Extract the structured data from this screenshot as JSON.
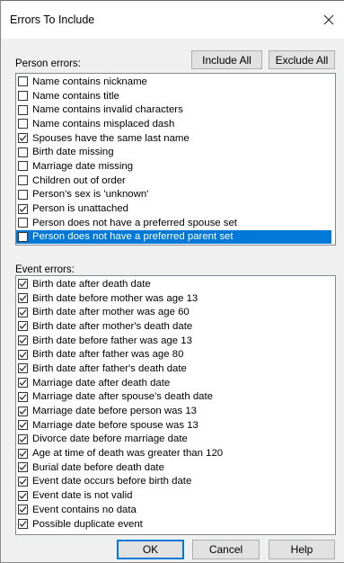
{
  "dialog": {
    "title": "Errors To Include"
  },
  "person": {
    "label": "Person errors:",
    "include_all": "Include All",
    "exclude_all": "Exclude All",
    "items": [
      {
        "label": "Name contains nickname",
        "checked": false
      },
      {
        "label": "Name contains title",
        "checked": false
      },
      {
        "label": "Name contains invalid characters",
        "checked": false
      },
      {
        "label": "Name contains misplaced dash",
        "checked": false
      },
      {
        "label": "Spouses have the same last name",
        "checked": true
      },
      {
        "label": "Birth date missing",
        "checked": false
      },
      {
        "label": "Marriage date missing",
        "checked": false
      },
      {
        "label": "Children out of order",
        "checked": false
      },
      {
        "label": "Person's sex is 'unknown'",
        "checked": false
      },
      {
        "label": "Person is unattached",
        "checked": true
      },
      {
        "label": "Person does not have a preferred spouse set",
        "checked": false
      },
      {
        "label": "Person does not have a preferred parent set",
        "checked": false,
        "selected": true
      }
    ]
  },
  "event": {
    "label": "Event errors:",
    "items": [
      {
        "label": "Birth date after death date",
        "checked": true
      },
      {
        "label": "Birth date before mother was age 13",
        "checked": true
      },
      {
        "label": "Birth date after mother was age 60",
        "checked": true
      },
      {
        "label": "Birth date after mother's death date",
        "checked": true
      },
      {
        "label": "Birth date before father was age 13",
        "checked": true
      },
      {
        "label": "Birth date after father was age 80",
        "checked": true
      },
      {
        "label": "Birth date after father's death date",
        "checked": true
      },
      {
        "label": "Marriage date after death date",
        "checked": true
      },
      {
        "label": "Marriage date after spouse's death date",
        "checked": true
      },
      {
        "label": "Marriage date before person was 13",
        "checked": true
      },
      {
        "label": "Marriage date before spouse was 13",
        "checked": true
      },
      {
        "label": "Divorce date before marriage date",
        "checked": true
      },
      {
        "label": "Age at time of death was greater than 120",
        "checked": true
      },
      {
        "label": "Burial date before death date",
        "checked": true
      },
      {
        "label": "Event date occurs before birth date",
        "checked": true
      },
      {
        "label": "Event date is not valid",
        "checked": true
      },
      {
        "label": "Event contains no data",
        "checked": true
      },
      {
        "label": "Possible duplicate event",
        "checked": true
      }
    ]
  },
  "footer": {
    "ok": "OK",
    "cancel": "Cancel",
    "help": "Help"
  },
  "icons": {
    "close": "close-icon",
    "check": "checkmark-icon"
  },
  "colors": {
    "selection": "#0078d7",
    "default_button_border": "#0078d7"
  }
}
